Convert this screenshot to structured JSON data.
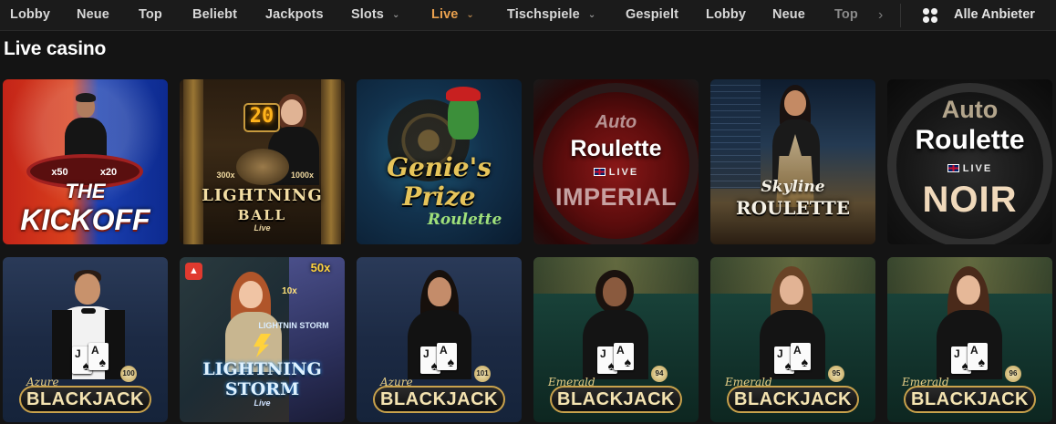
{
  "nav": {
    "items": [
      {
        "label": "Lobby",
        "dropdown": false,
        "active": false
      },
      {
        "label": "Neue",
        "dropdown": false,
        "active": false
      },
      {
        "label": "Top",
        "dropdown": false,
        "active": false
      },
      {
        "label": "Beliebt",
        "dropdown": false,
        "active": false
      },
      {
        "label": "Jackpots",
        "dropdown": false,
        "active": false
      },
      {
        "label": "Slots",
        "dropdown": true,
        "active": false
      },
      {
        "label": "Live",
        "dropdown": true,
        "active": true
      },
      {
        "label": "Tischspiele",
        "dropdown": true,
        "active": false
      },
      {
        "label": "Gespielt",
        "dropdown": false,
        "active": false
      },
      {
        "label": "Lobby",
        "dropdown": false,
        "active": false
      },
      {
        "label": "Neue",
        "dropdown": false,
        "active": false
      },
      {
        "label": "Top",
        "dropdown": false,
        "active": false
      }
    ],
    "scroll_arrow_icon": "chevron-right-icon",
    "provider_icon": "grid-dots-icon",
    "provider_label": "Alle Anbieter",
    "active_color": "#e9a04e"
  },
  "section": {
    "title": "Live casino"
  },
  "games": {
    "row1": [
      {
        "line1": "THE",
        "line2": "KICKOFF",
        "left_mult": "x50",
        "right_mult": "x20"
      },
      {
        "number": "20",
        "line1": "LIGHTNING",
        "line2": "BALL",
        "tag": "Live",
        "left_mult": "300x",
        "right_mult": "1000x"
      },
      {
        "line1": "Genie's",
        "line2": "Prize",
        "line3": "Roulette"
      },
      {
        "line1": "Auto",
        "line2": "Roulette",
        "live": "LIVE",
        "line3": "IMPERIAL"
      },
      {
        "line1": "Skyline",
        "line2": "ROULETTE"
      },
      {
        "line1": "Auto",
        "line2": "Roulette",
        "live": "LIVE",
        "line3": "NOIR"
      }
    ],
    "row2": [
      {
        "script": "Azure",
        "title": "BLACKJACK",
        "table": "100"
      },
      {
        "line1": "LIGHTNING",
        "line2": "STORM",
        "tag": "Live",
        "mult_top": "50x",
        "mult_mid": "10x",
        "mini": "LIGHTNIN STORM",
        "badge_icon": "fire-icon"
      },
      {
        "script": "Azure",
        "title": "BLACKJACK",
        "table": "101"
      },
      {
        "script": "Emerald",
        "title": "BLACKJACK",
        "table": "94"
      },
      {
        "script": "Emerald",
        "title": "BLACKJACK",
        "table": "95"
      },
      {
        "script": "Emerald",
        "title": "BLACKJACK",
        "table": "96"
      }
    ],
    "card_rank": "J",
    "card_rank2": "A",
    "card_suit": "♠"
  }
}
